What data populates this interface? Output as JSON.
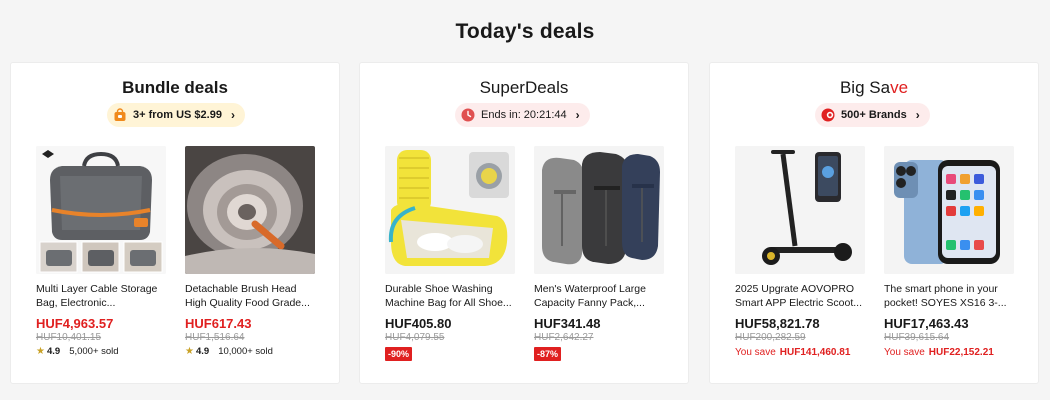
{
  "page": {
    "title": "Today's deals"
  },
  "cards": [
    {
      "title": "Bundle deals",
      "pill_label": "3+ from US $2.99",
      "products": [
        {
          "name": "Multi Layer Cable Storage Bag, Electronic...",
          "price": "HUF4,963.57",
          "original_price": "HUF10,401.15",
          "rating": "4.9",
          "sold": "5,000+ sold"
        },
        {
          "name": "Detachable Brush Head High Quality Food Grade...",
          "price": "HUF617.43",
          "original_price": "HUF1,516.64",
          "rating": "4.9",
          "sold": "10,000+ sold"
        }
      ]
    },
    {
      "title": "SuperDeals",
      "pill_label": "Ends in: 20:21:44",
      "products": [
        {
          "name": "Durable Shoe Washing Machine Bag for All Shoe...",
          "price": "HUF405.80",
          "original_price": "HUF4,079.55",
          "discount": "-90%"
        },
        {
          "name": "Men's Waterproof Large Capacity Fanny Pack,...",
          "price": "HUF341.48",
          "original_price": "HUF2,642.27",
          "discount": "-87%"
        }
      ]
    },
    {
      "title_part1": "Big Sa",
      "title_part2": "ve",
      "pill_label": "500+ Brands",
      "products": [
        {
          "name": "2025 Upgrate AOVOPRO Smart APP Electric Scoot...",
          "price": "HUF58,821.78",
          "original_price": "HUF200,282.59",
          "save_label": "You save",
          "save_amount": "HUF141,460.81"
        },
        {
          "name": "The smart phone in your pocket! SOYES XS16 3-...",
          "price": "HUF17,463.43",
          "original_price": "HUF39,615.64",
          "save_label": "You save",
          "save_amount": "HUF22,152.21"
        }
      ]
    }
  ],
  "icons": {
    "pill_chevron": "chevron-right-icon",
    "bundle_pill": "shopping-bag-icon",
    "superdeals_pill": "clock-icon",
    "bigsave_pill": "sale-tag-icon",
    "rating": "star-icon"
  },
  "colors": {
    "sale_red": "#e02020",
    "bundle_pill_bg": "#fff4d6",
    "deal_pill_bg": "#fdecec",
    "star_gold": "#c9a227"
  }
}
